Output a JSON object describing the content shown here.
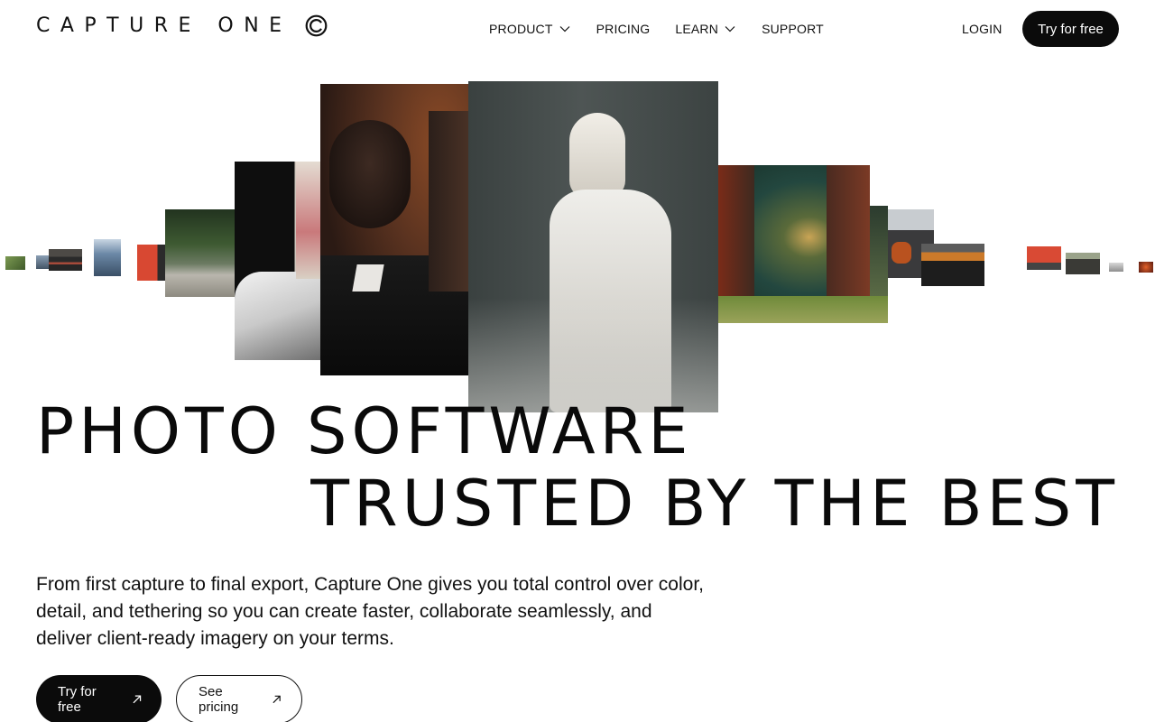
{
  "brand": {
    "name": "CAPTURE ONE"
  },
  "nav": {
    "items": [
      {
        "label": "PRODUCT",
        "has_dropdown": true
      },
      {
        "label": "PRICING",
        "has_dropdown": false
      },
      {
        "label": "LEARN",
        "has_dropdown": true
      },
      {
        "label": "SUPPORT",
        "has_dropdown": false
      }
    ],
    "login": "LOGIN",
    "cta": "Try for free"
  },
  "hero": {
    "headline_line1": "PHOTO SOFTWARE",
    "headline_line2": "TRUSTED BY THE BEST",
    "description": "From first capture to final export, Capture One gives you total control over color, detail, and tethering so you can create faster, collaborate seamlessly, and deliver client-ready imagery on your terms.",
    "primary_cta": "Try for free",
    "secondary_cta": "See pricing"
  },
  "colors": {
    "primary": "#0b0b0b",
    "background": "#ffffff"
  }
}
